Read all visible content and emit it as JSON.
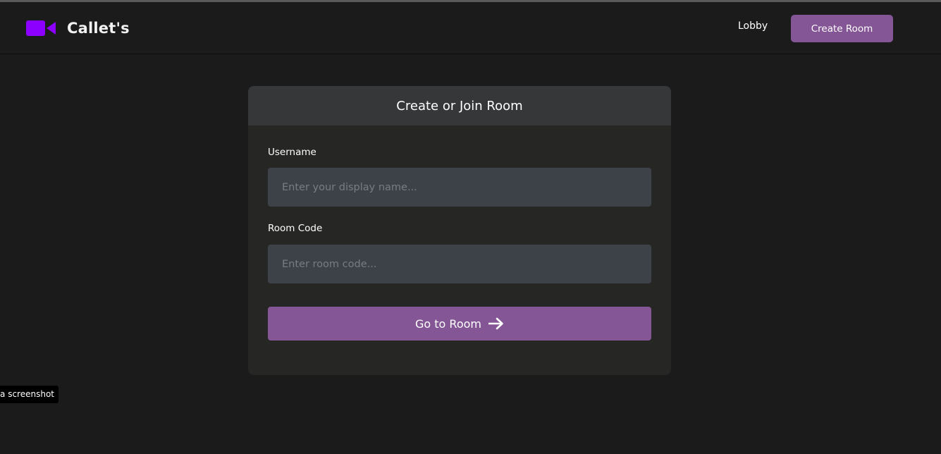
{
  "brand": {
    "name": "Callet's",
    "logo_icon": "video-camera-icon",
    "logo_color": "#8b00ff"
  },
  "nav": {
    "lobby_label": "Lobby",
    "create_room_label": "Create Room"
  },
  "form": {
    "title": "Create or Join Room",
    "username": {
      "label": "Username",
      "placeholder": "Enter your display name...",
      "value": ""
    },
    "room_code": {
      "label": "Room Code",
      "placeholder": "Enter room code...",
      "value": ""
    },
    "submit_label": "Go to Room",
    "submit_icon": "arrow-right-icon"
  },
  "tooltip": {
    "text": "e a screenshot"
  },
  "colors": {
    "background": "#1b1b1b",
    "accent": "#845695",
    "card": "#262625",
    "card_header": "#363739",
    "input": "#3d4249"
  }
}
